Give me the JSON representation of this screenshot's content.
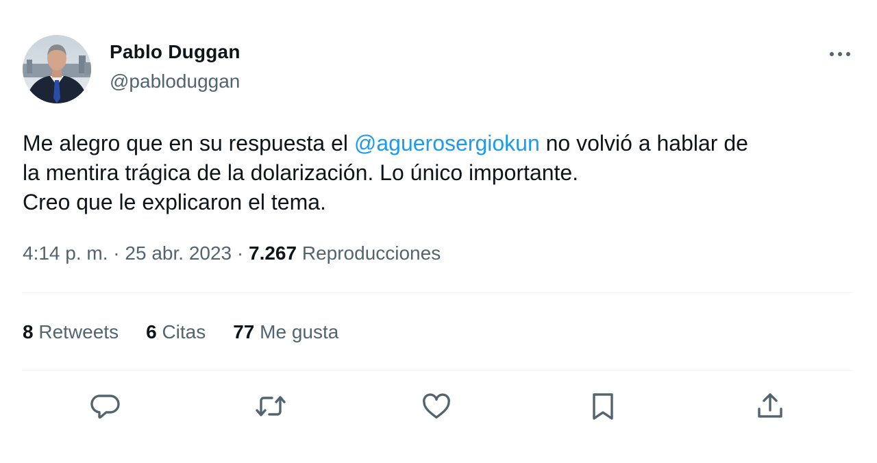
{
  "author": {
    "name": "Pablo Duggan",
    "handle": "@pabloduggan"
  },
  "tweet": {
    "line1_before": "Me alegro que en su respuesta el ",
    "mention": "@aguerosergiokun",
    "line1_after": " no volvió a hablar de",
    "line2": "la mentira trágica de la dolarización. Lo único importante.",
    "line3": "Creo que le explicaron el tema."
  },
  "meta": {
    "time": "4:14 p. m.",
    "separator": "·",
    "date": "25 abr. 2023",
    "views_count": "7.267",
    "views_label": "Reproducciones"
  },
  "stats": {
    "retweets_count": "8",
    "retweets_label": "Retweets",
    "quotes_count": "6",
    "quotes_label": "Citas",
    "likes_count": "77",
    "likes_label": "Me gusta"
  },
  "icons": {
    "more": "more-dots-icon",
    "reply": "reply-icon",
    "retweet": "retweet-icon",
    "like": "heart-icon",
    "bookmark": "bookmark-icon",
    "share": "share-icon"
  },
  "colors": {
    "text": "#0f1419",
    "secondary": "#536471",
    "link": "#1d9bf0",
    "divider": "#eff3f4"
  }
}
